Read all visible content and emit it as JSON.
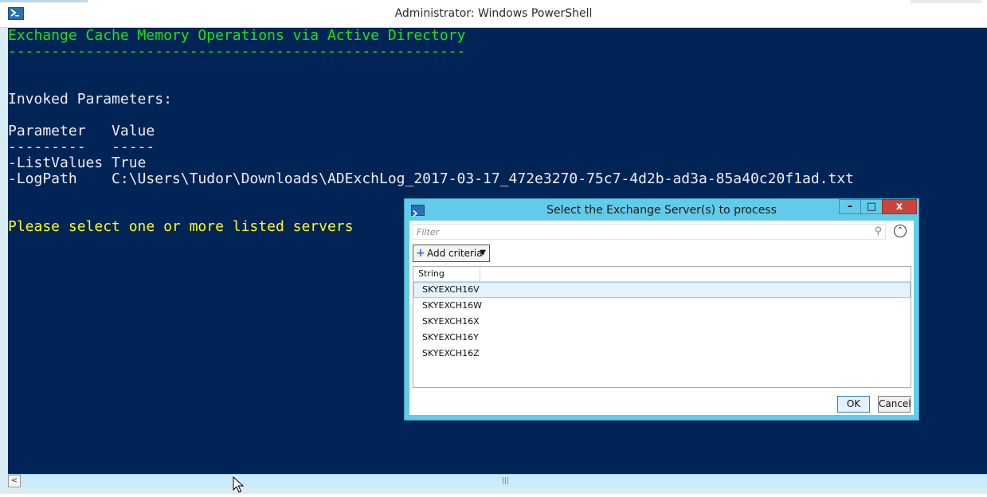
{
  "window": {
    "title": "Administrator: Windows PowerShell"
  },
  "console": {
    "heading": "Exchange Cache Memory Operations via Active Directory",
    "heading_underline": "-----------------------------------------------------",
    "invoked_label": "Invoked Parameters:",
    "table_header": "Parameter   Value",
    "table_divider": "---------   -----",
    "rows": [
      "-ListValues True",
      "-LogPath    C:\\Users\\Tudor\\Downloads\\ADExchLog_2017-03-17_472e3270-75c7-4d2b-ad3a-85a40c20f1ad.txt"
    ],
    "prompt": "Please select one or more listed servers",
    "colors": {
      "background": "#012456",
      "heading": "#14e814",
      "text": "#eeedf0",
      "prompt": "#ffff00"
    }
  },
  "dialog": {
    "title": "Select the Exchange Server(s) to process",
    "filter_placeholder": "Filter",
    "add_criteria_label": "Add criteria",
    "column_header": "String",
    "items": [
      "SKYEXCH16V",
      "SKYEXCH16W",
      "SKYEXCH16X",
      "SKYEXCH16Y",
      "SKYEXCH16Z"
    ],
    "selected_item": "SKYEXCH16V",
    "ok_label": "OK",
    "cancel_label": "Cancel"
  },
  "icons": {
    "app": "powershell-icon",
    "search": "search-icon",
    "collapse": "chevron-up-icon",
    "minimize": "minimize-icon",
    "maximize": "maximize-icon",
    "close": "close-icon",
    "add": "plus-icon",
    "dropdown": "caret-down-icon",
    "scroll_left": "arrow-left-icon",
    "cursor": "mouse-pointer-icon"
  }
}
